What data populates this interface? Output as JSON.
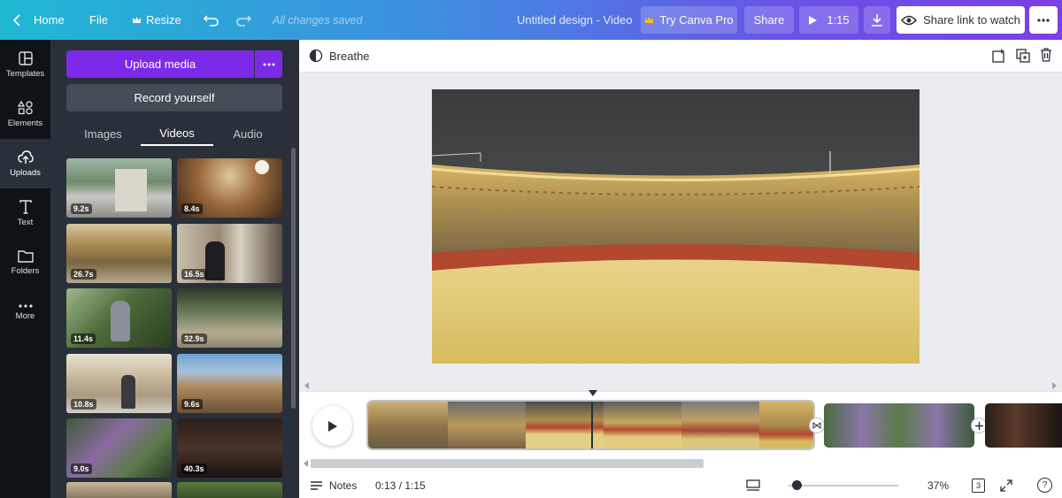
{
  "topbar": {
    "home": "Home",
    "file": "File",
    "resize": "Resize",
    "saved": "All changes saved",
    "design_title": "Untitled design - Video",
    "try_pro": "Try Canva Pro",
    "share": "Share",
    "duration": "1:15",
    "share_link": "Share link to watch"
  },
  "rail": [
    {
      "label": "Templates",
      "icon": "templates-icon"
    },
    {
      "label": "Elements",
      "icon": "elements-icon"
    },
    {
      "label": "Uploads",
      "icon": "uploads-icon"
    },
    {
      "label": "Text",
      "icon": "text-icon"
    },
    {
      "label": "Folders",
      "icon": "folders-icon"
    },
    {
      "label": "More",
      "icon": "more-icon"
    }
  ],
  "panel": {
    "upload": "Upload media",
    "record": "Record yourself",
    "tabs": [
      "Images",
      "Videos",
      "Audio"
    ],
    "active_tab": "Videos",
    "videos": [
      "9.2s",
      "8.4s",
      "26.7s",
      "16.5s",
      "11.4s",
      "32.9s",
      "10.8s",
      "9.6s",
      "9.0s",
      "40.3s",
      "",
      ""
    ]
  },
  "editor": {
    "animation": "Breathe"
  },
  "timeline": {
    "playhead_fraction": 0.173
  },
  "bottom": {
    "notes": "Notes",
    "time": "0:13 / 1:15",
    "zoom": "37%",
    "pages": "3",
    "help": "?"
  },
  "colors": {
    "accent": "#7d2ae8",
    "rail_bg": "#0e1318",
    "panel_bg": "#293039"
  }
}
